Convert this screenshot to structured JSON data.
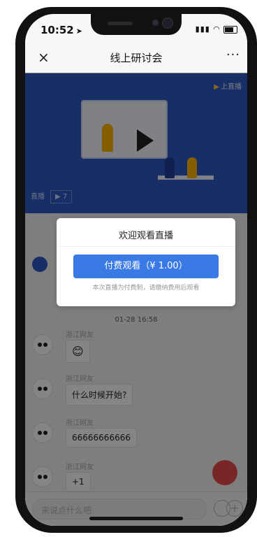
{
  "status_bar": {
    "time": "10:52",
    "location_icon": "location-arrow-icon",
    "signal_icon": "cellular-signal-icon",
    "wifi_icon": "wifi-icon",
    "battery_icon": "battery-icon"
  },
  "nav": {
    "close_label": "×",
    "title": "线上研讨会",
    "more_label": "···"
  },
  "video": {
    "brand": "上直播",
    "live_tag": "直播",
    "view_count": "7",
    "play_icon": "play-icon"
  },
  "feed": {
    "timestamp": "01-28 16:58",
    "messages": [
      {
        "name": "浙江网友",
        "text": "😊"
      },
      {
        "name": "浙江网友",
        "text": "什么时候开始?"
      },
      {
        "name": "浙江网友",
        "text": "66666666666"
      },
      {
        "name": "浙江网友",
        "text": "+1"
      }
    ]
  },
  "input": {
    "placeholder": "来说点什么吧",
    "plus_label": "+"
  },
  "modal": {
    "title": "欢迎观看直播",
    "pay_button": "付费观看（¥ 1.00）",
    "note": "本次直播为付费制，请缴纳费用后观看"
  },
  "colors": {
    "accent": "#3a7ae5",
    "video_bg": "#2e59c5",
    "overlay": "rgba(0,0,0,0.48)"
  }
}
